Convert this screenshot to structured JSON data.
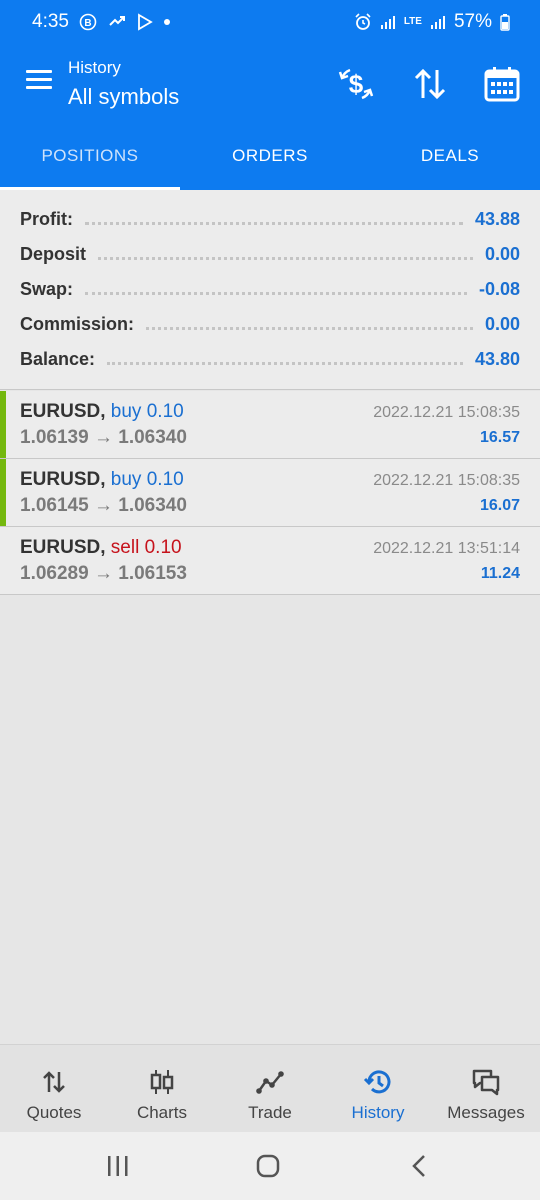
{
  "status_bar": {
    "time": "4:35",
    "battery": "57%",
    "lte_label": "LTE"
  },
  "header": {
    "subtitle": "History",
    "title": "All symbols"
  },
  "tabs": [
    {
      "label": "POSITIONS",
      "active": true
    },
    {
      "label": "ORDERS",
      "active": false
    },
    {
      "label": "DEALS",
      "active": false
    }
  ],
  "summary": [
    {
      "label": "Profit:",
      "value": "43.88"
    },
    {
      "label": "Deposit",
      "value": "0.00"
    },
    {
      "label": "Swap:",
      "value": "-0.08"
    },
    {
      "label": "Commission:",
      "value": "0.00"
    },
    {
      "label": "Balance:",
      "value": "43.80"
    }
  ],
  "deals": [
    {
      "symbol": "EURUSD,",
      "side": "buy",
      "volume": "0.10",
      "open": "1.06139",
      "arrow": "→",
      "close": "1.06340",
      "time": "2022.12.21 15:08:35",
      "profit": "16.57"
    },
    {
      "symbol": "EURUSD,",
      "side": "buy",
      "volume": "0.10",
      "open": "1.06145",
      "arrow": "→",
      "close": "1.06340",
      "time": "2022.12.21 15:08:35",
      "profit": "16.07"
    },
    {
      "symbol": "EURUSD,",
      "side": "sell",
      "volume": "0.10",
      "open": "1.06289",
      "arrow": "→",
      "close": "1.06153",
      "time": "2022.12.21 13:51:14",
      "profit": "11.24"
    }
  ],
  "bottom_nav": [
    {
      "label": "Quotes",
      "icon": "quotes-icon"
    },
    {
      "label": "Charts",
      "icon": "candles-icon"
    },
    {
      "label": "Trade",
      "icon": "trade-icon"
    },
    {
      "label": "History",
      "icon": "history-icon",
      "active": true
    },
    {
      "label": "Messages",
      "icon": "messages-icon"
    }
  ],
  "colors": {
    "primary": "#0d7bf0",
    "buy": "#1a6fd1",
    "sell": "#c6131c",
    "buy_bar": "#74b80e"
  }
}
